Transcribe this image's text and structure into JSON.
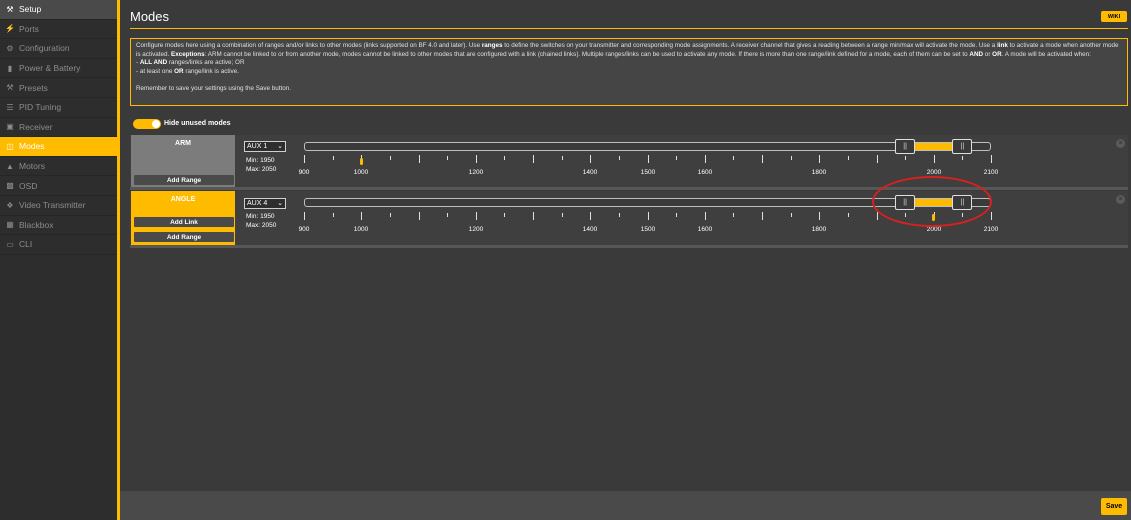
{
  "sidebar": {
    "items": [
      {
        "label": "Setup",
        "icon": "wrench-icon"
      },
      {
        "label": "Ports",
        "icon": "plug-icon"
      },
      {
        "label": "Configuration",
        "icon": "gear-icon"
      },
      {
        "label": "Power & Battery",
        "icon": "battery-icon"
      },
      {
        "label": "Presets",
        "icon": "wrench-icon"
      },
      {
        "label": "PID Tuning",
        "icon": "sliders-icon"
      },
      {
        "label": "Receiver",
        "icon": "receiver-icon"
      },
      {
        "label": "Modes",
        "icon": "modes-icon"
      },
      {
        "label": "Motors",
        "icon": "motor-icon"
      },
      {
        "label": "OSD",
        "icon": "osd-icon"
      },
      {
        "label": "Video Transmitter",
        "icon": "antenna-icon"
      },
      {
        "label": "Blackbox",
        "icon": "blackbox-icon"
      },
      {
        "label": "CLI",
        "icon": "terminal-icon"
      }
    ],
    "active": "Modes"
  },
  "header": {
    "title": "Modes",
    "wiki_label": "WIKI"
  },
  "note": {
    "p1_a": "Configure modes here using a combination of ranges and/or links to other modes (links supported on BF 4.0 and later). Use ",
    "p1_b": "ranges",
    "p1_c": " to define the switches on your transmitter and corresponding mode assignments. A receiver channel that gives a reading between a range min/max will activate the mode. Use a ",
    "p1_d": "link",
    "p1_e": " to activate a mode when another mode is activated. ",
    "p1_f": "Exceptions",
    "p1_g": ": ARM cannot be linked to or from another mode, modes cannot be linked to other modes that are configured with a link (chained links). Multiple ranges/links can be used to activate any mode. If there is more than one range/link defined for a mode, each of them can be set to ",
    "p1_h": "AND",
    "p1_i": " or ",
    "p1_j": "OR",
    "p1_k": ". A mode will be activated when:",
    "l1_a": "- ",
    "l1_b": "ALL AND",
    "l1_c": " ranges/links are active; OR",
    "l2_a": "- at least one ",
    "l2_b": "OR",
    "l2_c": " range/link is active.",
    "footer": "Remember to save your settings using the Save button."
  },
  "toggle": {
    "label": "Hide unused modes",
    "on": true
  },
  "modes": [
    {
      "name": "ARM",
      "buttons": [
        "Add Range"
      ],
      "channel": "AUX 1",
      "min_label": "Min: 1950",
      "max_label": "Max: 2050",
      "range_min": 1950,
      "range_max": 2050,
      "current_value": 1000
    },
    {
      "name": "ANGLE",
      "buttons": [
        "Add Link",
        "Add Range"
      ],
      "channel": "AUX 4",
      "min_label": "Min: 1950",
      "max_label": "Max: 2050",
      "range_min": 1950,
      "range_max": 2050,
      "current_value": 2000
    }
  ],
  "scale": {
    "min": 900,
    "max": 2100,
    "labels": [
      "900",
      "1000",
      "1200",
      "1400",
      "1500",
      "1600",
      "1800",
      "2000",
      "2100"
    ]
  },
  "footer": {
    "save_label": "Save"
  },
  "colors": {
    "accent": "#ffbb00",
    "annotation": "#d92020"
  }
}
